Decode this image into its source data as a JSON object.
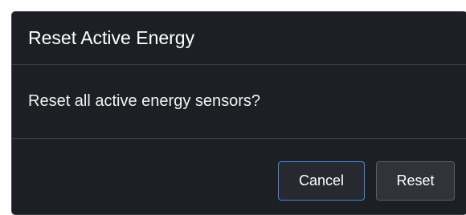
{
  "dialog": {
    "title": "Reset Active Energy",
    "message": "Reset all active energy sensors?",
    "cancel_label": "Cancel",
    "confirm_label": "Reset"
  },
  "colors": {
    "background": "#1c1f24",
    "divider": "#3b4048",
    "focus_border": "#4a88d6",
    "text": "#ffffff"
  }
}
